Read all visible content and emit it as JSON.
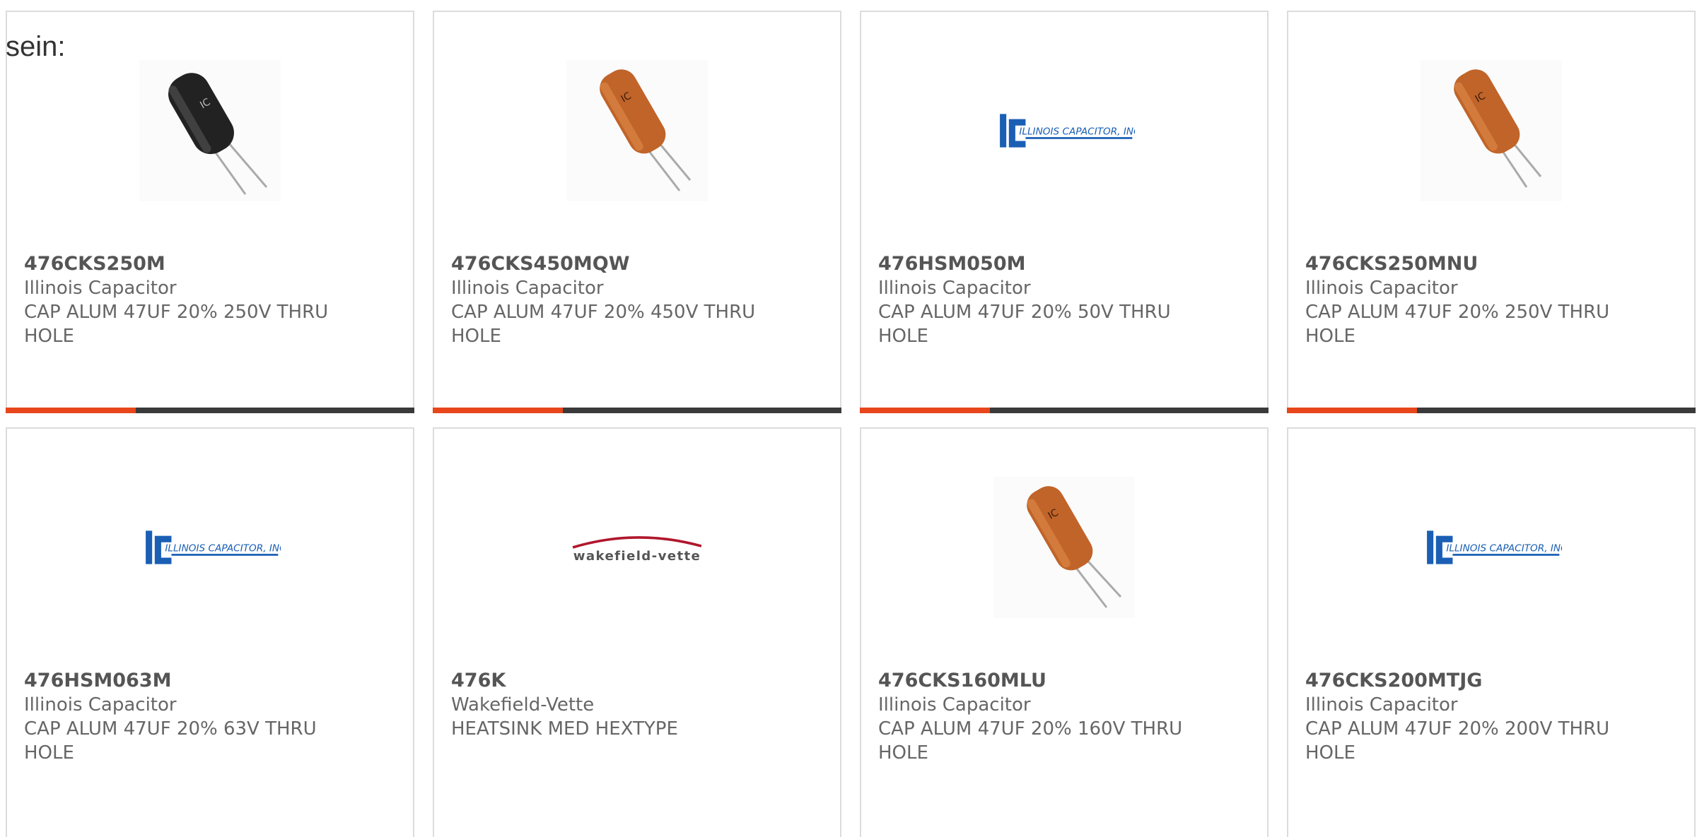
{
  "intro": "sein:",
  "colors": {
    "accent": "#e8461b",
    "bar": "#3a3a3a",
    "logo_blue": "#1a5fb4"
  },
  "products": [
    {
      "part": "476CKS250M",
      "manufacturer": "Illinois Capacitor",
      "description": "CAP ALUM 47UF 20% 250V THRU HOLE",
      "image": "black-capacitor",
      "highlight": true
    },
    {
      "part": "476CKS450MQW",
      "manufacturer": "Illinois Capacitor",
      "description": "CAP ALUM 47UF 20% 450V THRU HOLE",
      "image": "orange-capacitor",
      "highlight": true
    },
    {
      "part": "476HSM050M",
      "manufacturer": "Illinois Capacitor",
      "description": "CAP ALUM 47UF 20% 50V THRU HOLE",
      "image": "ic-logo",
      "highlight": true
    },
    {
      "part": "476CKS250MNU",
      "manufacturer": "Illinois Capacitor",
      "description": "CAP ALUM 47UF 20% 250V THRU HOLE",
      "image": "orange-capacitor",
      "highlight": true
    },
    {
      "part": "476HSM063M",
      "manufacturer": "Illinois Capacitor",
      "description": "CAP ALUM 47UF 20% 63V THRU HOLE",
      "image": "ic-logo",
      "highlight": false
    },
    {
      "part": "476K",
      "manufacturer": "Wakefield-Vette",
      "description": "HEATSINK MED HEXTYPE",
      "image": "wakefield-logo",
      "highlight": false
    },
    {
      "part": "476CKS160MLU",
      "manufacturer": "Illinois Capacitor",
      "description": "CAP ALUM 47UF 20% 160V THRU HOLE",
      "image": "orange-capacitor",
      "highlight": false
    },
    {
      "part": "476CKS200MTJG",
      "manufacturer": "Illinois Capacitor",
      "description": "CAP ALUM 47UF 20% 200V THRU HOLE",
      "image": "ic-logo",
      "highlight": false
    }
  ],
  "logos": {
    "ic": "ILLINOIS CAPACITOR, INC.",
    "wakefield": "wakefield-vette"
  }
}
